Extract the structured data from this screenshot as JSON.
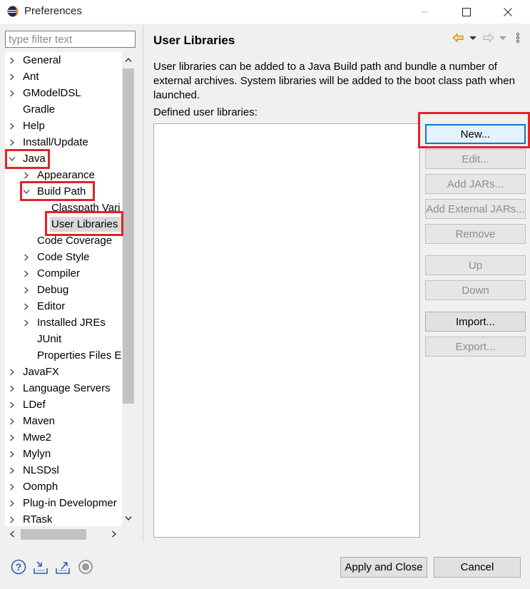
{
  "window": {
    "title": "Preferences"
  },
  "filter": {
    "placeholder": "type filter text"
  },
  "tree": [
    {
      "label": "General",
      "level": 0,
      "expander": "collapsed"
    },
    {
      "label": "Ant",
      "level": 0,
      "expander": "collapsed"
    },
    {
      "label": "GModelDSL",
      "level": 0,
      "expander": "collapsed"
    },
    {
      "label": "Gradle",
      "level": 0,
      "expander": "none"
    },
    {
      "label": "Help",
      "level": 0,
      "expander": "collapsed"
    },
    {
      "label": "Install/Update",
      "level": 0,
      "expander": "collapsed"
    },
    {
      "label": "Java",
      "level": 0,
      "expander": "expanded"
    },
    {
      "label": "Appearance",
      "level": 1,
      "expander": "collapsed"
    },
    {
      "label": "Build Path",
      "level": 1,
      "expander": "expanded"
    },
    {
      "label": "Classpath Vari",
      "level": 2,
      "expander": "none"
    },
    {
      "label": "User Libraries",
      "level": 2,
      "expander": "none",
      "selected": true
    },
    {
      "label": "Code Coverage",
      "level": 1,
      "expander": "none"
    },
    {
      "label": "Code Style",
      "level": 1,
      "expander": "collapsed"
    },
    {
      "label": "Compiler",
      "level": 1,
      "expander": "collapsed"
    },
    {
      "label": "Debug",
      "level": 1,
      "expander": "collapsed"
    },
    {
      "label": "Editor",
      "level": 1,
      "expander": "collapsed"
    },
    {
      "label": "Installed JREs",
      "level": 1,
      "expander": "collapsed"
    },
    {
      "label": "JUnit",
      "level": 1,
      "expander": "none"
    },
    {
      "label": "Properties Files Ec",
      "level": 1,
      "expander": "none"
    },
    {
      "label": "JavaFX",
      "level": 0,
      "expander": "collapsed"
    },
    {
      "label": "Language Servers",
      "level": 0,
      "expander": "collapsed"
    },
    {
      "label": "LDef",
      "level": 0,
      "expander": "collapsed"
    },
    {
      "label": "Maven",
      "level": 0,
      "expander": "collapsed"
    },
    {
      "label": "Mwe2",
      "level": 0,
      "expander": "collapsed"
    },
    {
      "label": "Mylyn",
      "level": 0,
      "expander": "collapsed"
    },
    {
      "label": "NLSDsl",
      "level": 0,
      "expander": "collapsed"
    },
    {
      "label": "Oomph",
      "level": 0,
      "expander": "collapsed"
    },
    {
      "label": "Plug-in Developmer",
      "level": 0,
      "expander": "collapsed"
    },
    {
      "label": "RTask",
      "level": 0,
      "expander": "collapsed"
    }
  ],
  "page": {
    "title": "User Libraries",
    "description": "User libraries can be added to a Java Build path and bundle a number of external archives. System libraries will be added to the boot class path when launched.",
    "list_label": "Defined user libraries:"
  },
  "buttons": {
    "new": "New...",
    "edit": "Edit...",
    "add_jars": "Add JARs...",
    "add_external_jars": "Add External JARs...",
    "remove": "Remove",
    "up": "Up",
    "down": "Down",
    "import": "Import...",
    "export": "Export..."
  },
  "footer": {
    "apply_close": "Apply and Close",
    "cancel": "Cancel"
  },
  "colors": {
    "highlight": "#e0242b",
    "default_button_border": "#0078d7"
  }
}
